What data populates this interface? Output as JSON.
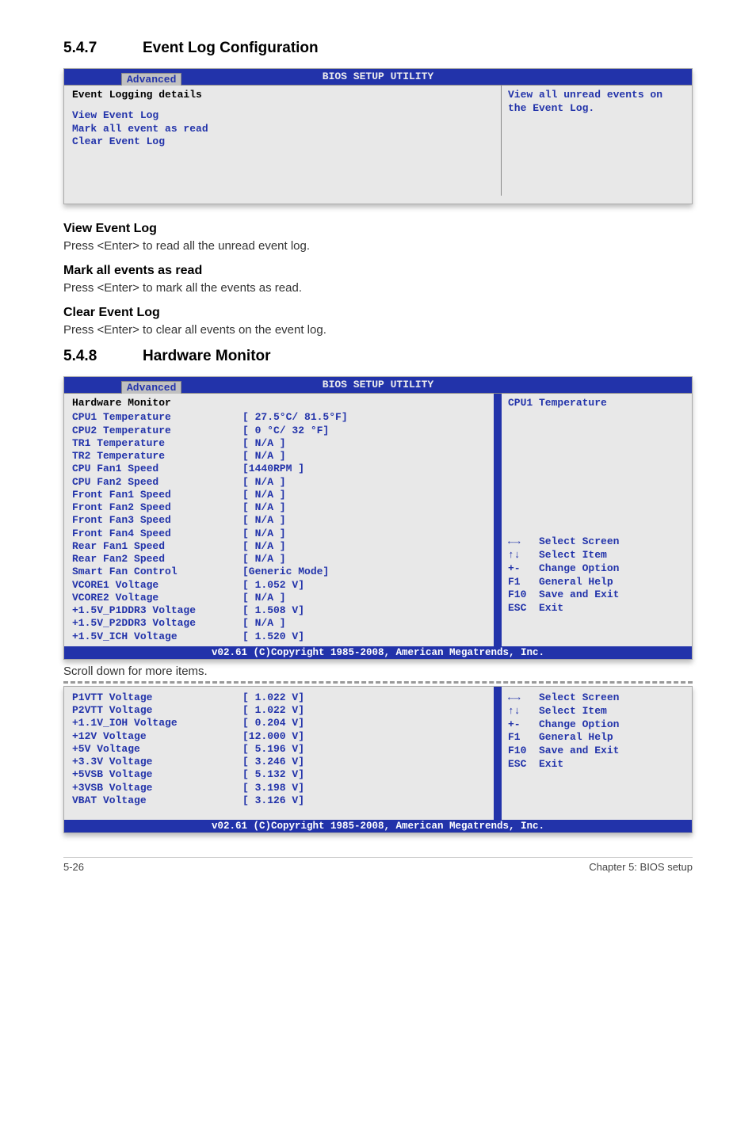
{
  "section547": {
    "num": "5.4.7",
    "title": "Event Log Configuration"
  },
  "bios1": {
    "title": "BIOS SETUP UTILITY",
    "tab": "Advanced",
    "panelHeader": "Event Logging details",
    "items": [
      "View Event Log",
      "Mark all event as read",
      "Clear Event Log"
    ],
    "help": "View all unread events on the Event Log."
  },
  "sub1": {
    "head": "View Event Log",
    "text": "Press <Enter> to read all the unread event log."
  },
  "sub2": {
    "head": "Mark all events as read",
    "text": "Press <Enter> to mark all the events as read."
  },
  "sub3": {
    "head": "Clear Event Log",
    "text": "Press <Enter> to clear all events on the event log."
  },
  "section548": {
    "num": "5.4.8",
    "title": "Hardware Monitor"
  },
  "bios2": {
    "title": "BIOS SETUP UTILITY",
    "tab": "Advanced",
    "panelHeader": "Hardware Monitor",
    "rows": [
      {
        "label": "CPU1 Temperature",
        "val": "[ 27.5°C/ 81.5°F]"
      },
      {
        "label": "CPU2 Temperature",
        "val": "[ 0   °C/ 32  °F]"
      },
      {
        "label": "TR1 Temperature",
        "val": "[  N/A  ]"
      },
      {
        "label": "TR2 Temperature",
        "val": "[  N/A  ]"
      },
      {
        "label": "CPU Fan1 Speed",
        "val": "[1440RPM ]"
      },
      {
        "label": "CPU Fan2 Speed",
        "val": "[  N/A   ]"
      },
      {
        "label": "Front Fan1 Speed",
        "val": "[  N/A   ]"
      },
      {
        "label": "Front Fan2 Speed",
        "val": "[  N/A   ]"
      },
      {
        "label": "Front Fan3 Speed",
        "val": "[  N/A   ]"
      },
      {
        "label": "Front Fan4 Speed",
        "val": "[  N/A   ]"
      },
      {
        "label": "Rear Fan1 Speed",
        "val": "[  N/A   ]"
      },
      {
        "label": "Rear Fan2 Speed",
        "val": "[  N/A   ]"
      },
      {
        "label": "Smart Fan Control",
        "val": "[Generic Mode]"
      },
      {
        "label": "VCORE1 Voltage",
        "val": "[ 1.052 V]"
      },
      {
        "label": "VCORE2 Voltage",
        "val": "[  N/A  ]"
      },
      {
        "label": "+1.5V_P1DDR3 Voltage",
        "val": "[ 1.508 V]"
      },
      {
        "label": "+1.5V_P2DDR3 Voltage",
        "val": "[  N/A  ]"
      },
      {
        "label": "+1.5V_ICH Voltage",
        "val": "[ 1.520 V]"
      }
    ],
    "help": "CPU1 Temperature",
    "nav": [
      "←→   Select Screen",
      "↑↓   Select Item",
      "+-   Change Option",
      "F1   General Help",
      "F10  Save and Exit",
      "ESC  Exit"
    ],
    "footer": "v02.61 (C)Copyright 1985-2008, American Megatrends, Inc."
  },
  "scrollNote": "Scroll down for more items.",
  "bios3": {
    "rows": [
      {
        "label": "P1VTT Voltage",
        "val": "[ 1.022 V]"
      },
      {
        "label": "P2VTT Voltage",
        "val": "[ 1.022 V]"
      },
      {
        "label": "+1.1V_IOH Voltage",
        "val": "[ 0.204 V]"
      },
      {
        "label": "+12V Voltage",
        "val": "[12.000 V]"
      },
      {
        "label": "+5V Voltage",
        "val": "[ 5.196 V]"
      },
      {
        "label": "+3.3V Voltage",
        "val": "[ 3.246 V]"
      },
      {
        "label": "+5VSB Voltage",
        "val": "[ 5.132 V]"
      },
      {
        "label": "+3VSB Voltage",
        "val": "[ 3.198 V]"
      },
      {
        "label": "VBAT Voltage",
        "val": "[ 3.126 V]"
      }
    ],
    "nav": [
      "←→   Select Screen",
      "↑↓   Select Item",
      "+-   Change Option",
      "F1   General Help",
      "F10  Save and Exit",
      "ESC  Exit"
    ],
    "footer": "v02.61 (C)Copyright 1985-2008, American Megatrends, Inc."
  },
  "footer": {
    "left": "5-26",
    "right": "Chapter 5: BIOS setup"
  }
}
